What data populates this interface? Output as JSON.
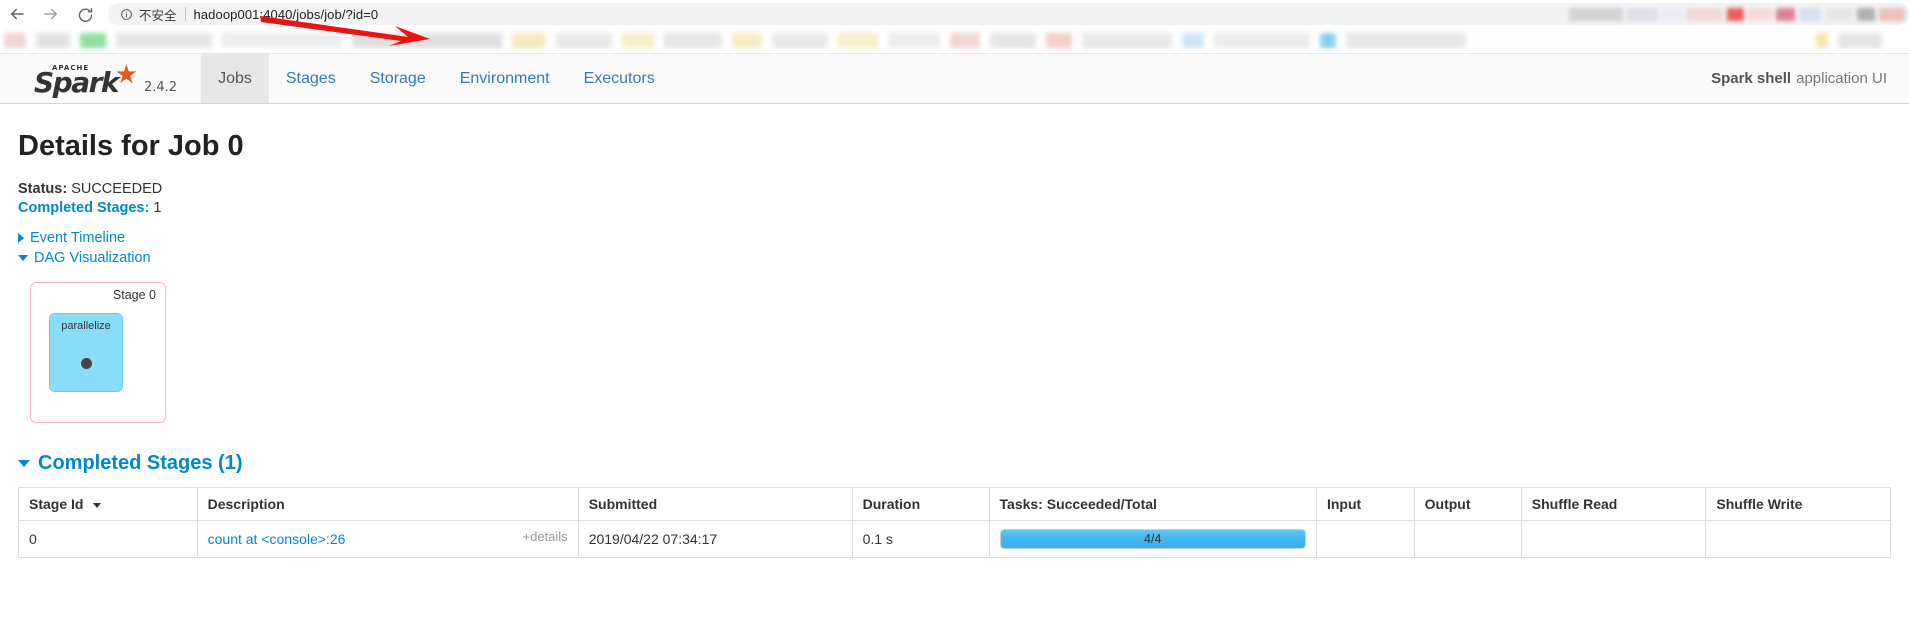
{
  "browser": {
    "back_icon": "arrow-left-icon",
    "forward_icon": "arrow-right-icon",
    "reload_icon": "reload-icon",
    "info_icon": "info-circle-icon",
    "security_label": "不安全",
    "url": "hadoop001:4040/jobs/job/?id=0",
    "annotation": "red-arrow-pointing-right"
  },
  "navbar": {
    "brand": {
      "apache_label": "APACHE",
      "wordmark": "Spark",
      "star_glyph": "★",
      "version": "2.4.2"
    },
    "tabs": [
      {
        "label": "Jobs",
        "active": true
      },
      {
        "label": "Stages",
        "active": false
      },
      {
        "label": "Storage",
        "active": false
      },
      {
        "label": "Environment",
        "active": false
      },
      {
        "label": "Executors",
        "active": false
      }
    ],
    "app_title_bold": "Spark shell",
    "app_title_rest": "application UI"
  },
  "page": {
    "title": "Details for Job 0",
    "status_label": "Status:",
    "status_value": "SUCCEEDED",
    "completed_stages_label": "Completed Stages:",
    "completed_stages_value": "1",
    "event_timeline_label": "Event Timeline",
    "dag_visualization_label": "DAG Visualization"
  },
  "dag": {
    "stage_label": "Stage 0",
    "rdd_label": "parallelize",
    "stage_border_color": "#f7b6c2",
    "rdd_fill_color": "#89ddf9"
  },
  "completed_stages_section": {
    "heading": "Completed Stages (1)",
    "columns": [
      "Stage Id",
      "Description",
      "Submitted",
      "Duration",
      "Tasks: Succeeded/Total",
      "Input",
      "Output",
      "Shuffle Read",
      "Shuffle Write"
    ],
    "rows": [
      {
        "stage_id": "0",
        "description": "count at <console>:26",
        "details_toggle": "+details",
        "submitted": "2019/04/22 07:34:17",
        "duration": "0.1 s",
        "tasks_text": "4/4",
        "tasks_percent": 100,
        "input": "",
        "output": "",
        "shuffle_read": "",
        "shuffle_write": ""
      }
    ]
  }
}
